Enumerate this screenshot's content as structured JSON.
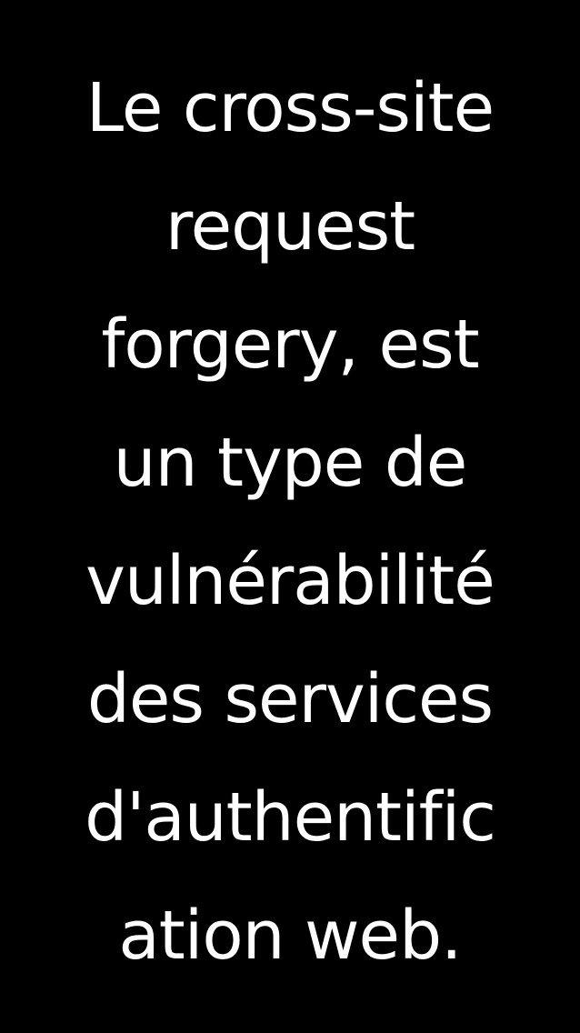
{
  "theme": {
    "background": "#000000",
    "text_color": "#ffffff"
  },
  "message": {
    "lines": [
      "Le cross-site",
      "request",
      "forgery, est",
      "un type de",
      "vulnérabilité",
      "des services",
      "d'authentific",
      "ation web."
    ]
  }
}
